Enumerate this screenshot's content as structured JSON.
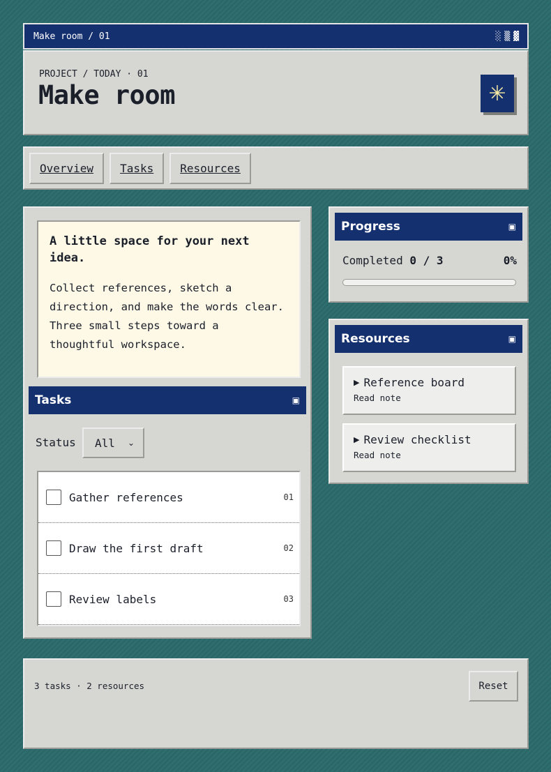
{
  "window": {
    "title": "Make room / 01",
    "controls": [
      "░",
      "▒",
      "▓"
    ]
  },
  "header": {
    "eyebrow": "PROJECT / TODAY · 01",
    "title": "Make room",
    "logo_glyph": "✳"
  },
  "nav": {
    "tabs": [
      {
        "label": "Overview"
      },
      {
        "label": "Tasks"
      },
      {
        "label": "Resources"
      }
    ]
  },
  "note": {
    "title": "A little space for your next idea.",
    "body": "Collect references, sketch a direction, and make the words clear. Three small steps toward a thoughtful workspace."
  },
  "tasks": {
    "heading": "Tasks",
    "minimize_icon": "▣",
    "status_label": "Status",
    "status_selected": "All",
    "items": [
      {
        "label": "Gather references",
        "num": "01",
        "done": false
      },
      {
        "label": "Draw the first draft",
        "num": "02",
        "done": false
      },
      {
        "label": "Review labels",
        "num": "03",
        "done": false
      }
    ]
  },
  "progress": {
    "heading": "Progress",
    "minimize_icon": "▣",
    "completed_label": "Completed",
    "completed_value": "0 / 3",
    "percent_text": "0%",
    "fraction": 0
  },
  "resources": {
    "heading": "Resources",
    "minimize_icon": "▣",
    "items": [
      {
        "title": "Reference board",
        "sub": "Read note"
      },
      {
        "title": "Review checklist",
        "sub": "Read note"
      }
    ]
  },
  "footer": {
    "stats": "3 tasks · 2 resources",
    "reset_label": "Reset"
  },
  "colors": {
    "accent": "#15306f",
    "background": "#2e6e6e",
    "panel": "#d6d6d2",
    "note": "#fdf9e6",
    "logo_glyph": "#f5e9a4"
  }
}
